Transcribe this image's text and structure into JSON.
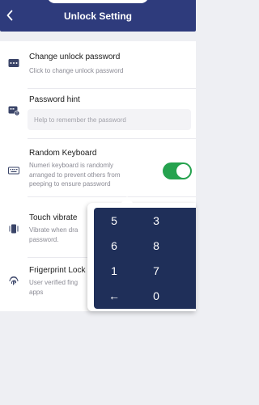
{
  "header": {
    "title": "Unlock Setting",
    "back_icon": "chevron-left-icon"
  },
  "settings": [
    {
      "id": "change-password",
      "label": "Change unlock password",
      "desc": "Click to change unlock password",
      "icon": "keyboard-dots-icon"
    },
    {
      "id": "password-hint",
      "label": "Password hint",
      "placeholder": "Help to remember the password",
      "icon": "keyboard-alert-icon"
    },
    {
      "id": "random-keyboard",
      "label": "Random Keyboard",
      "desc_lines": [
        "Numeri keyboard is randomly",
        "arranged to prevent others from",
        "peeping to ensure password"
      ],
      "toggle_on": true,
      "icon": "keyboard-icon"
    },
    {
      "id": "touch-vibrate",
      "label": "Touch vibrate",
      "desc_lines": [
        "Vibrate when dra",
        "password."
      ],
      "icon": "vibrate-icon"
    },
    {
      "id": "fingerprint-lock",
      "label": "Frigerprint Lock",
      "desc_lines": [
        "User verified fing",
        "apps"
      ],
      "icon": "fingerprint-icon"
    }
  ],
  "keypad": {
    "keys": [
      "5",
      "3",
      "6",
      "8",
      "1",
      "7",
      "←",
      "0"
    ]
  },
  "colors": {
    "header": "#2e3b7c",
    "toggle": "#25a24e",
    "keypad": "#1f2f59",
    "background": "#eeeff3"
  }
}
